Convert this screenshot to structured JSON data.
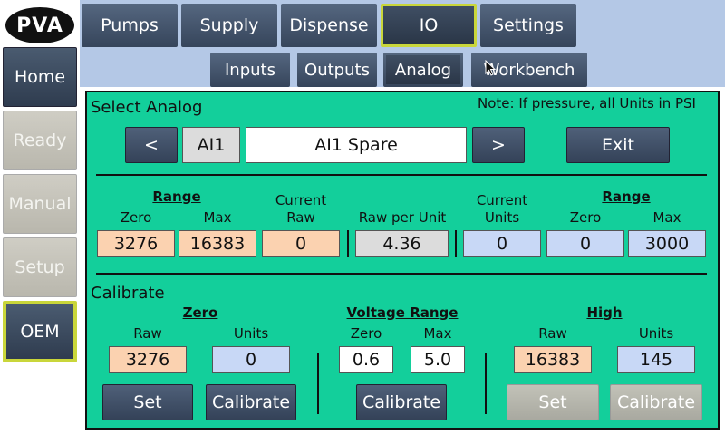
{
  "logo": "PVA",
  "sidebar": {
    "items": [
      {
        "label": "Home"
      },
      {
        "label": "Ready"
      },
      {
        "label": "Manual"
      },
      {
        "label": "Setup"
      },
      {
        "label": "OEM"
      }
    ]
  },
  "nav": {
    "tabs": [
      {
        "label": "Pumps"
      },
      {
        "label": "Supply"
      },
      {
        "label": "Dispense"
      },
      {
        "label": "IO"
      },
      {
        "label": "Settings"
      }
    ],
    "subtabs": [
      {
        "label": "Inputs"
      },
      {
        "label": "Outputs"
      },
      {
        "label": "Analog"
      },
      {
        "label": "Workbench"
      }
    ]
  },
  "select": {
    "title": "Select Analog",
    "note": "Note: If pressure, all Units in PSI",
    "prev": "<",
    "next": ">",
    "id": "AI1",
    "name": "AI1 Spare",
    "exit": "Exit"
  },
  "readout": {
    "range_left": "Range",
    "zero": "Zero",
    "max": "Max",
    "current_raw": "Current Raw",
    "raw_per_unit": "Raw per Unit",
    "current_units": "Current Units",
    "range_right": "Range",
    "zero_r": "Zero",
    "max_r": "Max",
    "zero_val": "3276",
    "max_val": "16383",
    "current_raw_val": "0",
    "raw_per_unit_val": "4.36",
    "current_units_val": "0",
    "zero_r_val": "0",
    "max_r_val": "3000"
  },
  "calibrate": {
    "title": "Calibrate",
    "zero_hdr": "Zero",
    "voltage_hdr": "Voltage Range",
    "high_hdr": "High",
    "raw": "Raw",
    "units": "Units",
    "v_zero": "Zero",
    "v_max": "Max",
    "raw_h": "Raw",
    "units_h": "Units",
    "zero_raw_val": "3276",
    "zero_units_val": "0",
    "v_zero_val": "0.6",
    "v_max_val": "5.0",
    "high_raw_val": "16383",
    "high_units_val": "145",
    "set": "Set",
    "calibrate": "Calibrate",
    "set_h": "Set",
    "calibrate_h": "Calibrate"
  }
}
